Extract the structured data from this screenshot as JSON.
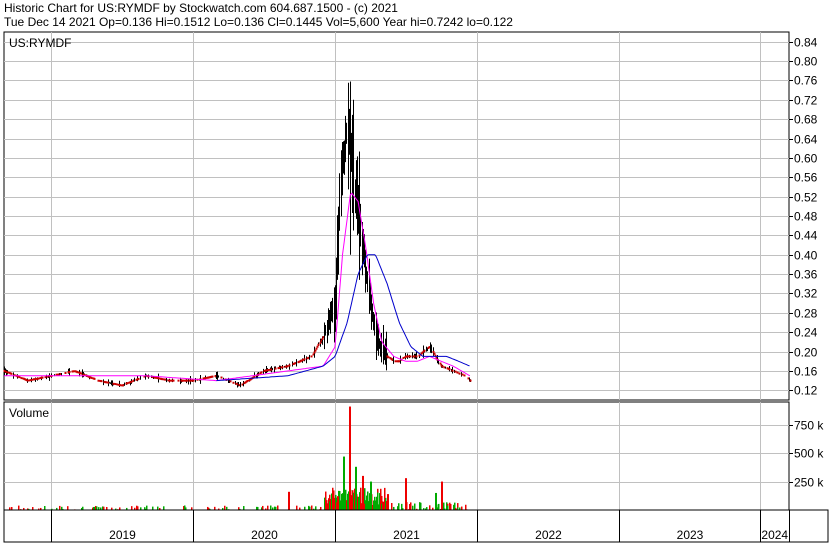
{
  "header": {
    "line1": "Historic Chart for US:RYMDF by Stockwatch.com 604.687.1500 - (c) 2021",
    "line2": "Tue Dec 14 2021   Op=0.136   Hi=0.1512   Lo=0.136   Cl=0.1445   Vol=5,600   Year hi=0.7242   lo=0.122"
  },
  "colors": {
    "price_bars": "#000000",
    "price_dots": "#cc0000",
    "ma_short": "#ff00ff",
    "ma_long": "#0000cc",
    "vol_up": "#00aa00",
    "vol_down": "#ee0000",
    "grid": "#c0c0c0"
  },
  "chart_data": [
    {
      "type": "line",
      "title": "US:RYMDF",
      "ylim": [
        0.1,
        0.86
      ],
      "y_ticks": [
        "0.84",
        "0.80",
        "0.76",
        "0.72",
        "0.68",
        "0.64",
        "0.60",
        "0.56",
        "0.52",
        "0.48",
        "0.44",
        "0.40",
        "0.36",
        "0.32",
        "0.28",
        "0.24",
        "0.20",
        "0.16",
        "0.12"
      ],
      "x_labels": [
        "2019",
        "2020",
        "2021",
        "2022",
        "2023",
        "2024"
      ],
      "x_domain": [
        "2018-09-01",
        "2024-03-15"
      ],
      "x_gridlines": [
        "2019-01-01",
        "2020-01-01",
        "2021-01-01",
        "2022-01-01",
        "2023-01-01",
        "2024-01-01"
      ],
      "grid": true,
      "series": [
        {
          "kind": "price",
          "x": [
            "2018-09-01",
            "2018-11-01",
            "2019-01-01",
            "2019-03-01",
            "2019-05-01",
            "2019-07-01",
            "2019-09-01",
            "2019-11-01",
            "2020-01-01",
            "2020-03-01",
            "2020-05-01",
            "2020-07-01",
            "2020-09-01",
            "2020-11-01",
            "2020-12-01",
            "2021-01-01",
            "2021-01-15",
            "2021-02-01",
            "2021-02-10",
            "2021-02-20",
            "2021-03-01",
            "2021-03-15",
            "2021-04-01",
            "2021-04-15",
            "2021-05-01",
            "2021-05-15",
            "2021-06-01",
            "2021-06-15",
            "2021-07-01",
            "2021-08-01",
            "2021-09-01",
            "2021-10-01",
            "2021-11-01",
            "2021-12-01",
            "2021-12-14"
          ],
          "y": [
            0.16,
            0.14,
            0.15,
            0.16,
            0.14,
            0.13,
            0.15,
            0.14,
            0.14,
            0.15,
            0.13,
            0.16,
            0.17,
            0.19,
            0.23,
            0.3,
            0.56,
            0.66,
            0.62,
            0.52,
            0.5,
            0.4,
            0.3,
            0.24,
            0.2,
            0.19,
            0.18,
            0.18,
            0.19,
            0.19,
            0.21,
            0.17,
            0.16,
            0.15,
            0.14
          ]
        },
        {
          "kind": "moving-average-short",
          "x": [
            "2018-09-01",
            "2019-03-01",
            "2019-09-01",
            "2020-03-01",
            "2020-09-01",
            "2020-12-01",
            "2021-01-01",
            "2021-01-20",
            "2021-02-10",
            "2021-03-01",
            "2021-03-20",
            "2021-04-10",
            "2021-05-01",
            "2021-06-01",
            "2021-07-01",
            "2021-08-01",
            "2021-09-01",
            "2021-10-01",
            "2021-11-01",
            "2021-12-14"
          ],
          "y": [
            0.15,
            0.15,
            0.15,
            0.14,
            0.16,
            0.17,
            0.21,
            0.4,
            0.53,
            0.51,
            0.42,
            0.3,
            0.22,
            0.19,
            0.18,
            0.18,
            0.19,
            0.18,
            0.17,
            0.15
          ]
        },
        {
          "kind": "moving-average-long",
          "x": [
            "2020-03-01",
            "2020-09-01",
            "2020-12-01",
            "2021-01-01",
            "2021-02-01",
            "2021-03-01",
            "2021-03-25",
            "2021-04-15",
            "2021-05-15",
            "2021-06-15",
            "2021-07-15",
            "2021-08-15",
            "2021-09-15",
            "2021-10-15",
            "2021-11-15",
            "2021-12-14"
          ],
          "y": [
            0.14,
            0.15,
            0.17,
            0.19,
            0.26,
            0.36,
            0.4,
            0.4,
            0.34,
            0.26,
            0.21,
            0.19,
            0.19,
            0.19,
            0.18,
            0.17
          ]
        }
      ]
    },
    {
      "type": "bar",
      "title": "Volume",
      "ylim": [
        0,
        950000
      ],
      "y_ticks": [
        "750 k",
        "500 k",
        "250 k"
      ],
      "y_tick_values": [
        750000,
        500000,
        250000
      ],
      "peaks": [
        {
          "x": "2020-09-01",
          "value": 160000,
          "direction": "down"
        },
        {
          "x": "2021-01-05",
          "value": 120000,
          "direction": "down"
        },
        {
          "x": "2021-01-20",
          "value": 470000,
          "direction": "up"
        },
        {
          "x": "2021-02-05",
          "value": 910000,
          "direction": "down"
        },
        {
          "x": "2021-02-20",
          "value": 380000,
          "direction": "up"
        },
        {
          "x": "2021-03-10",
          "value": 300000,
          "direction": "down"
        },
        {
          "x": "2021-04-01",
          "value": 250000,
          "direction": "up"
        },
        {
          "x": "2021-05-15",
          "value": 140000,
          "direction": "down"
        },
        {
          "x": "2021-07-01",
          "value": 280000,
          "direction": "down"
        },
        {
          "x": "2021-09-15",
          "value": 150000,
          "direction": "up"
        },
        {
          "x": "2021-10-01",
          "value": 250000,
          "direction": "down"
        }
      ]
    }
  ]
}
